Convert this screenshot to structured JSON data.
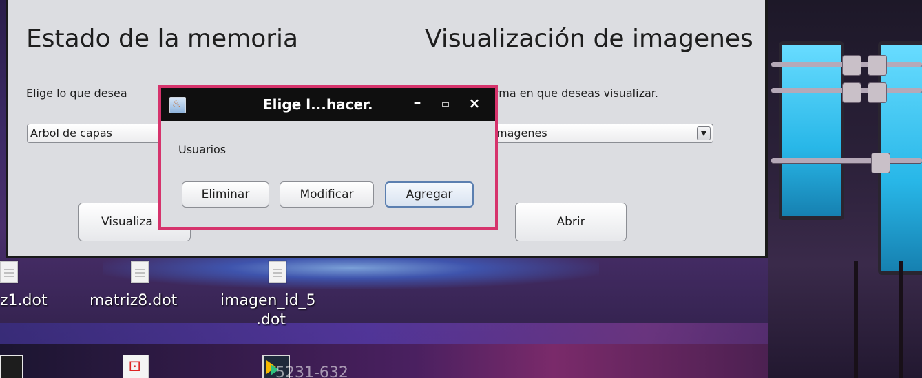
{
  "main_window": {
    "left_heading": "Estado de la memoria",
    "right_heading": "Visualización de imagenes",
    "left_instruction": "Elige lo que desea",
    "right_instruction": "rma en que deseas visualizar.",
    "left_combo_value": "Arbol de capas",
    "right_combo_value": "magenes",
    "visualizar_button": "Visualiza",
    "abrir_button": "Abrir"
  },
  "dialog": {
    "title": "Elige l...hacer.",
    "message": "Usuarios",
    "buttons": {
      "eliminar": "Eliminar",
      "modificar": "Modificar",
      "agregar": "Agregar"
    },
    "minimize_glyph": "–",
    "close_glyph": "×",
    "border_color": "#d6336c"
  },
  "desktop": {
    "icons": [
      {
        "label": "z1.dot"
      },
      {
        "label": "matriz8.dot"
      },
      {
        "label_line1": "imagen_id_5",
        "label_line2": ".dot"
      }
    ],
    "partial_bottom_text": "5231-632"
  },
  "icons": {
    "dialog_app_icon": "java-icon",
    "combo_arrow": "chevron-down-icon"
  }
}
